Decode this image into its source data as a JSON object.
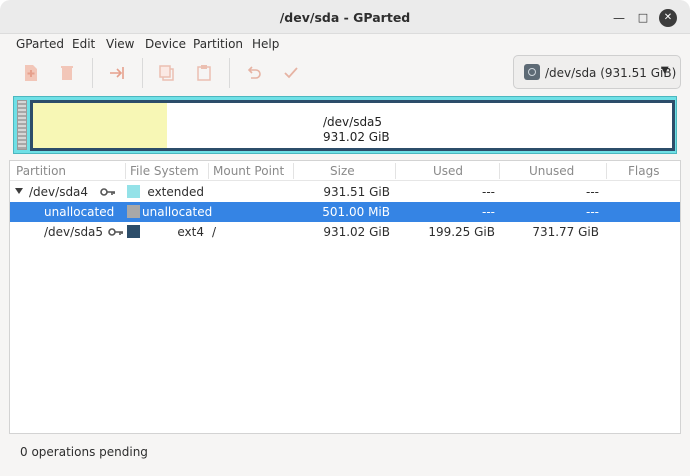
{
  "window": {
    "title": "/dev/sda - GParted"
  },
  "menubar": {
    "items": [
      "GParted",
      "Edit",
      "View",
      "Device",
      "Partition",
      "Help"
    ]
  },
  "toolbar": {
    "new": "new-partition-icon",
    "delete": "delete-icon",
    "resize": "resize-move-icon",
    "copy": "copy-icon",
    "paste": "paste-icon",
    "undo": "undo-icon",
    "apply": "apply-icon"
  },
  "device": {
    "label": "/dev/sda (931.51 GiB)"
  },
  "diskmap": {
    "name": "/dev/sda5",
    "size": "931.02 GiB",
    "used_fraction": 0.21,
    "colors": {
      "extended": "#7be0e7",
      "ext4": "#2c4d6a",
      "used": "#f7f7b5",
      "unallocated": "#a8a8a8"
    }
  },
  "table": {
    "headers": [
      "Partition",
      "File System",
      "Mount Point",
      "Size",
      "Used",
      "Unused",
      "Flags"
    ],
    "rows": [
      {
        "partition": "/dev/sda4",
        "filesystem": "extended",
        "mount": "",
        "size": "931.51 GiB",
        "used": "---",
        "unused": "---",
        "flags": "",
        "swatch": "#94e2e8",
        "key": true,
        "expander": true,
        "selected": false
      },
      {
        "partition": "unallocated",
        "filesystem": "unallocated",
        "mount": "",
        "size": "501.00 MiB",
        "used": "---",
        "unused": "---",
        "flags": "",
        "swatch": "#a8a8a8",
        "key": false,
        "expander": false,
        "selected": true
      },
      {
        "partition": "/dev/sda5",
        "filesystem": "ext4",
        "mount": "/",
        "size": "931.02 GiB",
        "used": "199.25 GiB",
        "unused": "731.77 GiB",
        "flags": "",
        "swatch": "#2c4d6a",
        "key": true,
        "expander": false,
        "selected": false
      }
    ]
  },
  "status": {
    "text": "0 operations pending"
  }
}
